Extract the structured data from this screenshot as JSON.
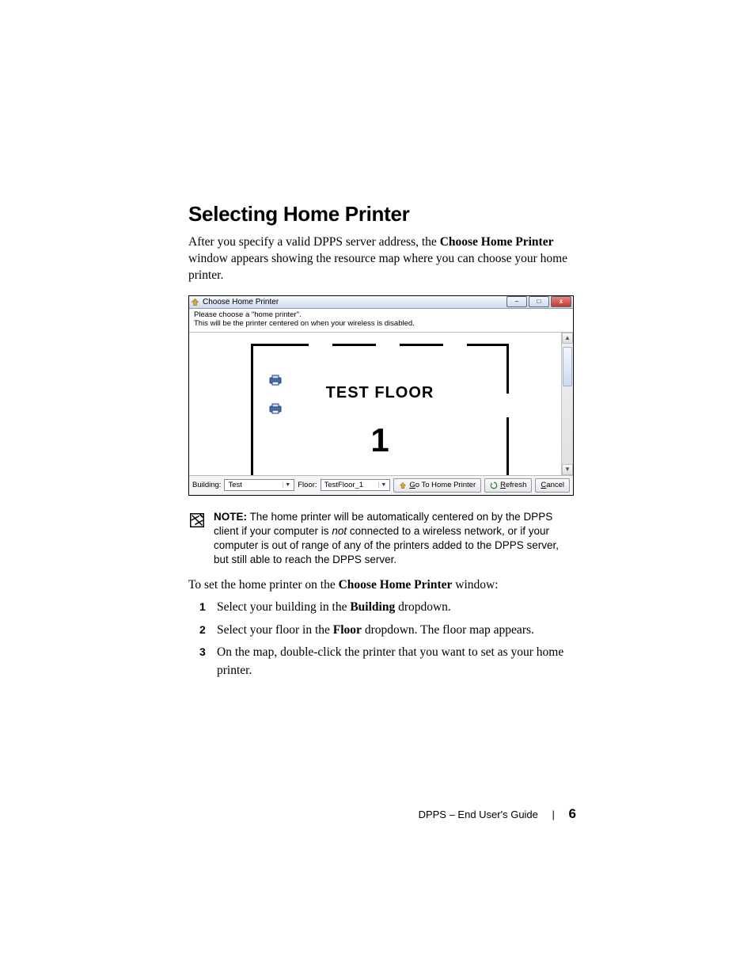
{
  "section": {
    "title": "Selecting Home Printer"
  },
  "intro": {
    "before": "After you specify a valid DPPS server address, the ",
    "bold": "Choose Home Printer",
    "after": " window appears showing the resource map where you can choose your home printer."
  },
  "window": {
    "title": "Choose Home Printer",
    "instruction_line1": "Please choose a \"home printer\".",
    "instruction_line2": "This will be the printer centered on when your wireless is disabled.",
    "map": {
      "label": "TEST FLOOR",
      "number": "1"
    },
    "bottom": {
      "building_label": "Building:",
      "building_value": "Test",
      "floor_label": "Floor:",
      "floor_value": "TestFloor_1",
      "goto_prefix": "G",
      "goto_rest": "o To Home Printer",
      "refresh_prefix": "R",
      "refresh_rest": "efresh",
      "cancel_prefix": "C",
      "cancel_rest": "ancel"
    }
  },
  "note": {
    "label": "NOTE:",
    "before": " The home printer will be automatically centered on by the DPPS client if your computer is ",
    "ital": "not",
    "after": " connected to a wireless network, or if your computer is out of range of any of the printers added to the DPPS server, but still able to reach the DPPS server."
  },
  "lead2": {
    "before": "To set the home printer on the ",
    "bold": "Choose Home Printer",
    "after": " window:"
  },
  "steps": [
    {
      "before": "Select your building in the ",
      "bold": "Building",
      "after": " dropdown."
    },
    {
      "before": "Select your floor in the ",
      "bold": "Floor",
      "after": " dropdown. The floor map appears."
    },
    {
      "before": "On the map, double-click the printer that you want to set as your home printer.",
      "bold": "",
      "after": ""
    }
  ],
  "footer": {
    "doc": "DPPS – End User's Guide",
    "page": "6"
  }
}
